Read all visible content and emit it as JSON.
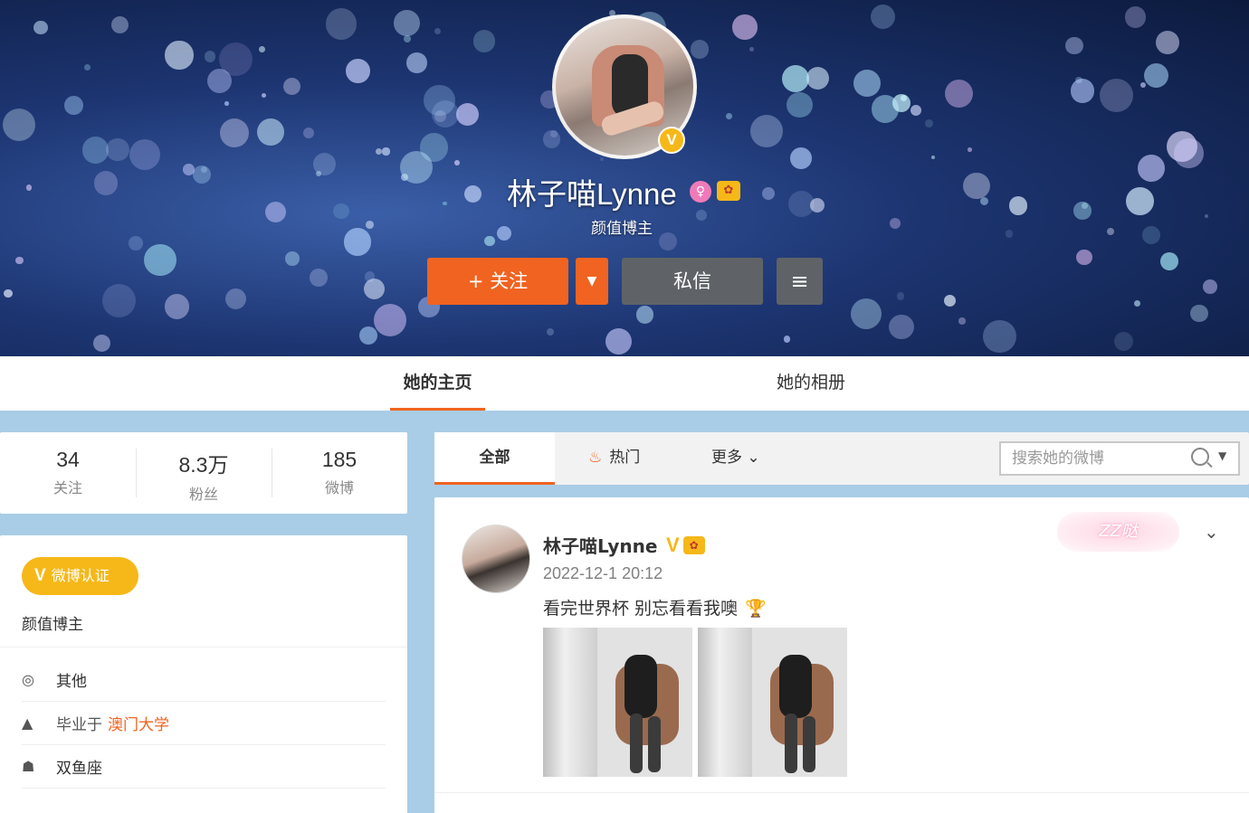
{
  "profile": {
    "name": "林子喵Lynne",
    "subtitle": "颜值博主",
    "verify_badge": "V"
  },
  "actions": {
    "follow_label": "+ 关注",
    "follow_dropdown": "▼",
    "message_label": "私信",
    "menu_icon": "≡"
  },
  "tabs": [
    {
      "label": "她的主页"
    },
    {
      "label": "她的相册"
    }
  ],
  "stats": [
    {
      "num": "34",
      "label": "关注"
    },
    {
      "num": "8.3万",
      "label": "粉丝"
    },
    {
      "num": "185",
      "label": "微博"
    }
  ],
  "info": {
    "verify_badge_label": "微博认证",
    "verify_text": "颜值博主",
    "location": "其他",
    "education_prefix": "毕业于",
    "education_school": "澳门大学",
    "zodiac": "双鱼座"
  },
  "feed": {
    "tabs": [
      "全部",
      "热门",
      "更多"
    ],
    "search_placeholder": "搜索她的微博"
  },
  "post": {
    "author": "林子喵Lynne",
    "time": "2022-12-1 20:12",
    "text": "看完世界杯 别忘看看我噢",
    "badge_text": "ZZ哒"
  },
  "colors": {
    "accent": "#f06320",
    "verify_gold": "#f6b819",
    "page_bg": "#a9cde6"
  }
}
